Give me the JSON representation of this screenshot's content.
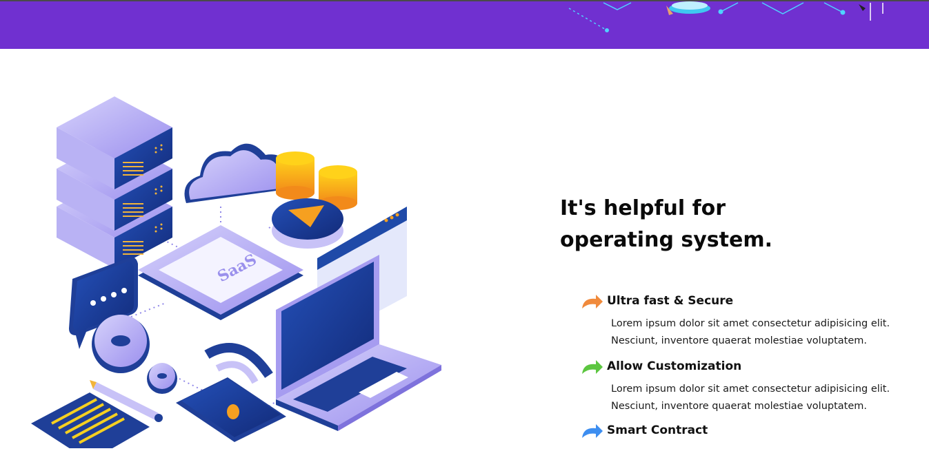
{
  "colors": {
    "banner": "#7030d0",
    "heading": "#0a0a0a",
    "accent_orange": "#f08a3c",
    "accent_green": "#5cc640",
    "accent_blue": "#3d8ef0",
    "illustration_primary": "#1f3f98",
    "illustration_lavender": "#a69cf0",
    "coin_gold": "#f6b020"
  },
  "illustration": {
    "caption_text": "SaaS",
    "icons": [
      "server-rack-icon",
      "cloud-icon",
      "coins-icon",
      "play-button-icon",
      "browser-window-icon",
      "chat-bubble-icon",
      "gear-icon",
      "laptop-icon",
      "smartphone-wifi-icon",
      "document-icon",
      "pencil-icon"
    ]
  },
  "main": {
    "heading": "It's helpful for operating system.",
    "features": [
      {
        "title": "Ultra fast & Secure",
        "icon": "curved-arrow-icon",
        "color": "#f08a3c",
        "desc_line1": "Lorem ipsum dolor sit amet consectetur adipisicing elit.",
        "desc_line2": "Nesciunt, inventore quaerat molestiae voluptatem."
      },
      {
        "title": "Allow Customization",
        "icon": "curved-arrow-icon",
        "color": "#5cc640",
        "desc_line1": "Lorem ipsum dolor sit amet consectetur adipisicing elit.",
        "desc_line2": "Nesciunt, inventore quaerat molestiae voluptatem."
      },
      {
        "title": "Smart Contract",
        "icon": "curved-arrow-icon",
        "color": "#3d8ef0"
      }
    ]
  }
}
